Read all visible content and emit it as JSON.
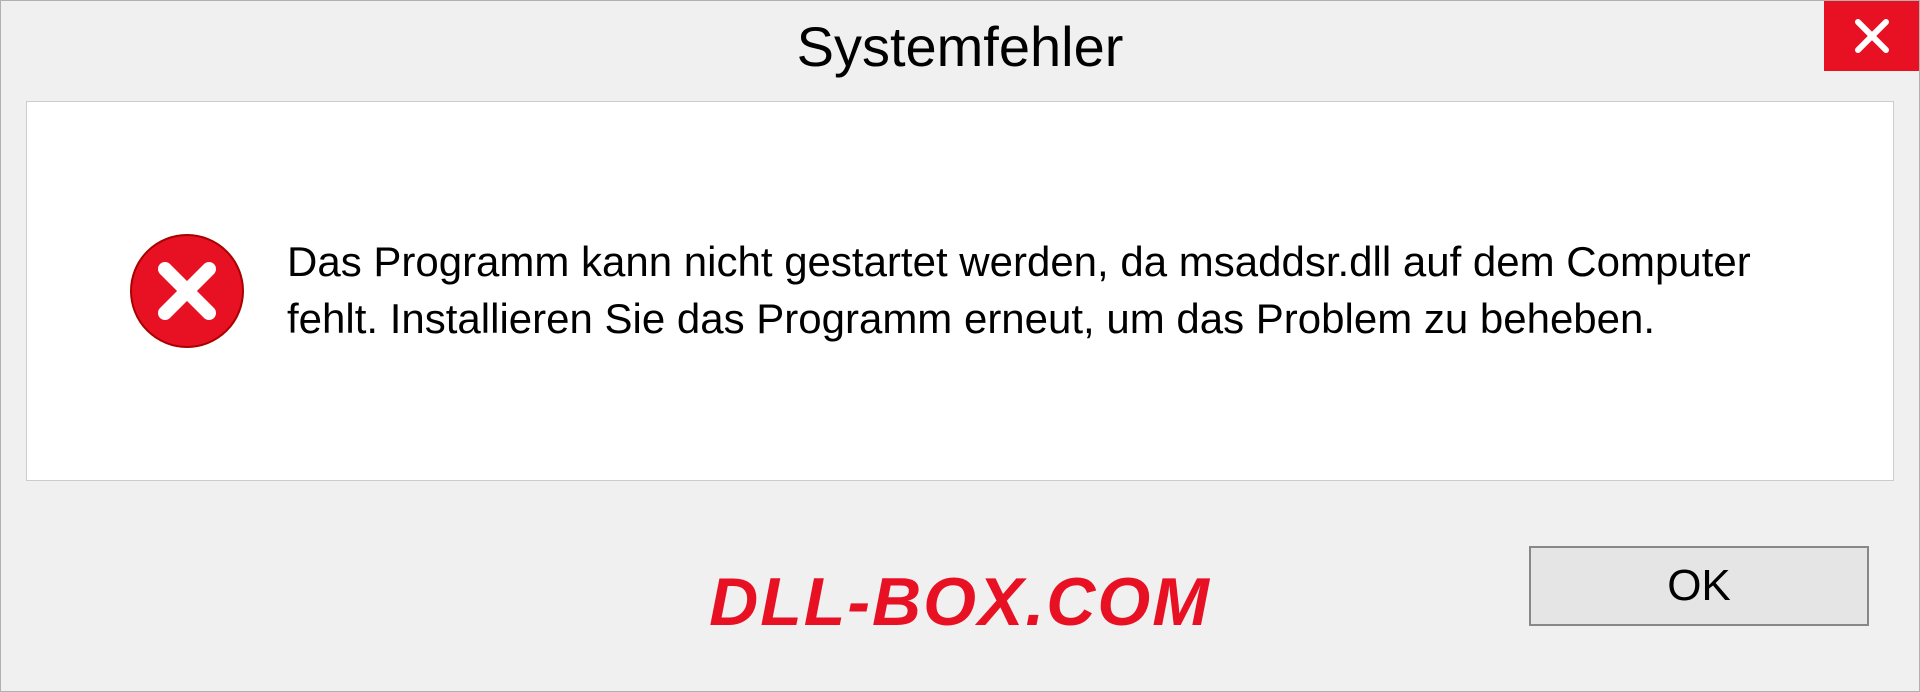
{
  "dialog": {
    "title": "Systemfehler",
    "message": "Das Programm kann nicht gestartet werden, da msaddsr.dll auf dem Computer fehlt. Installieren Sie das Programm erneut, um das Problem zu beheben.",
    "ok_label": "OK"
  },
  "watermark": "DLL-BOX.COM"
}
